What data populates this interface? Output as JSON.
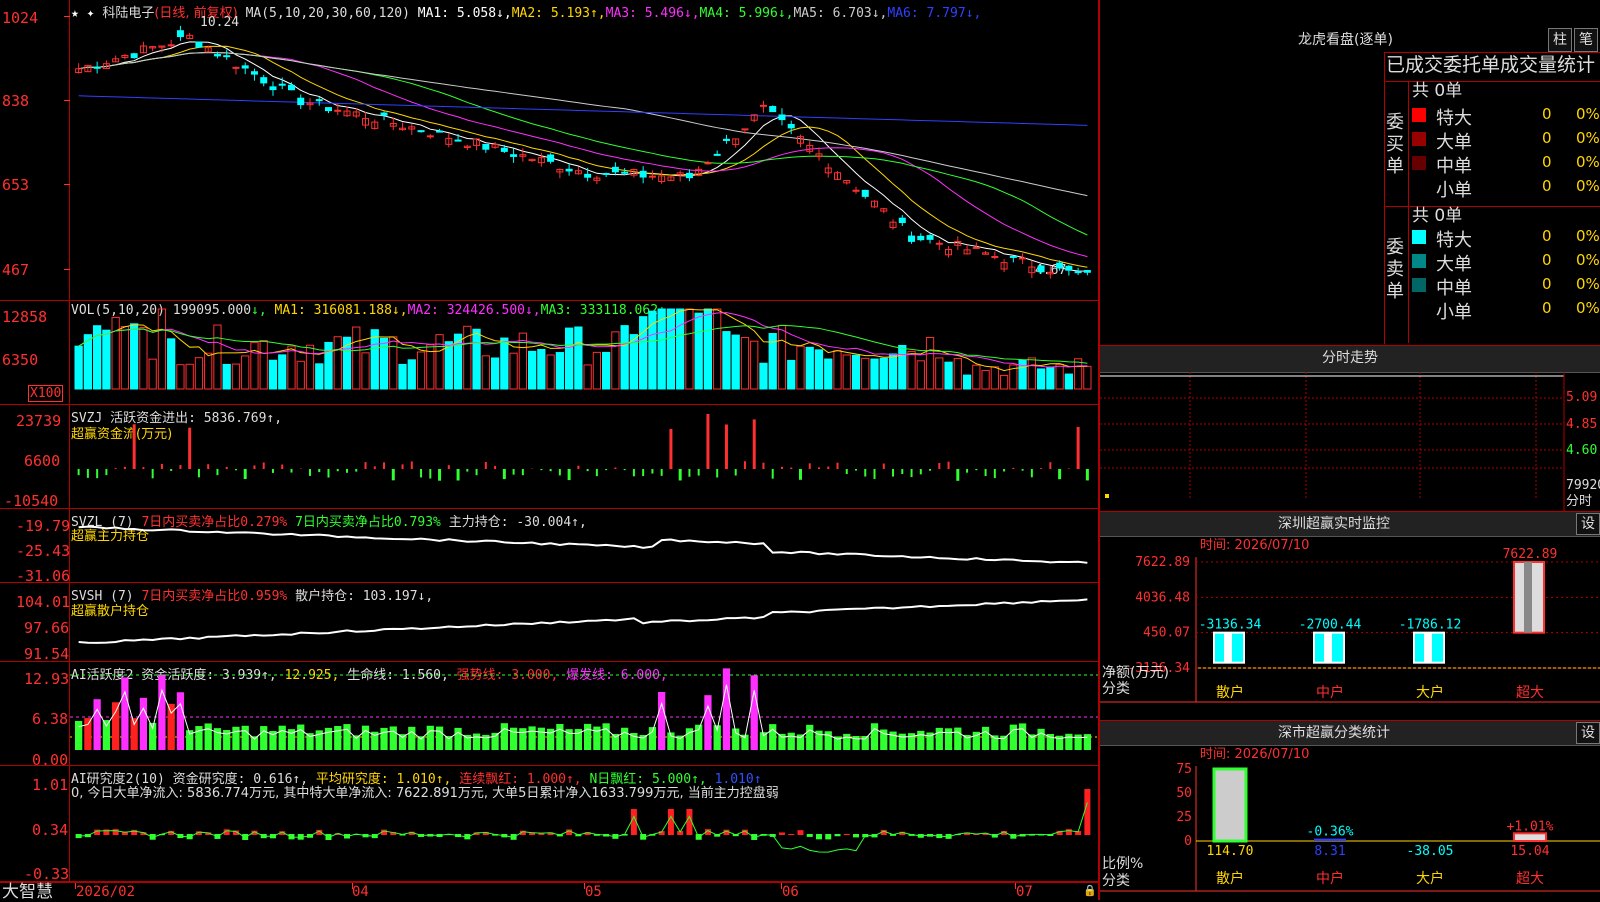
{
  "stock": {
    "name": "科陆电子",
    "mode": "(日线, 前复权)",
    "hi_label": "10.24",
    "lo_label": "4.67"
  },
  "price_pane": {
    "ma_label": "MA(5,10,20,30,60,120)",
    "items": [
      {
        "label": "MA1: 5.058",
        "arrow": "↓",
        "color": "#ffffff"
      },
      {
        "label": "MA2: 5.193",
        "arrow": "↑",
        "color": "#ffd700"
      },
      {
        "label": "MA3: 5.496",
        "arrow": "↓",
        "color": "#ff30ff"
      },
      {
        "label": "MA4: 5.996",
        "arrow": "↓",
        "color": "#30ff30"
      },
      {
        "label": "MA5: 6.703",
        "arrow": "↓",
        "color": "#cccccc"
      },
      {
        "label": "MA6: 7.797",
        "arrow": "↓",
        "color": "#3040ff"
      }
    ],
    "y_ticks": [
      "1024",
      "838",
      "653",
      "467"
    ]
  },
  "vol_pane": {
    "label": "VOL(5,10,20)",
    "value": "199095.000",
    "items": [
      {
        "label": "MA1: 316081.188",
        "arrow": "↓",
        "color": "#ffd700"
      },
      {
        "label": "MA2: 324426.500",
        "arrow": "↓",
        "color": "#ff30ff"
      },
      {
        "label": "MA3: 333118.062",
        "arrow": "↓",
        "color": "#30ff30"
      }
    ],
    "y_ticks": [
      "12858",
      "6350"
    ],
    "unit": "X100"
  },
  "svzj_pane": {
    "label": "SVZJ",
    "title": "活跃资金进出: 5836.769↑,",
    "subtitle": "超赢资金流(万元)",
    "y_ticks": [
      "23739",
      "6600",
      "-10540"
    ]
  },
  "svzl_pane": {
    "label": "SVZL (7)",
    "t1": "7日内买卖净占比0.279%",
    "t2": "7日内买卖净占比0.793%",
    "t3": "主力持仓: -30.004↑,",
    "subtitle": "超赢主力持仓",
    "y_ticks": [
      "-19.79",
      "-25.43",
      "-31.06"
    ]
  },
  "svsh_pane": {
    "label": "SVSH (7)",
    "t1": "7日内买卖净占比0.959%",
    "t2": "散户持仓: 103.197↓,",
    "subtitle": "超赢散户持仓",
    "y_ticks": [
      "104.01",
      "97.66",
      "91.54"
    ]
  },
  "ai_active_pane": {
    "label": "AI活跃度2",
    "t1": "资金活跃度: 3.939↑,",
    "t2": "12.925,",
    "t3": "生命线: 1.560,",
    "t4": "强势线: 3.000,",
    "t5": "爆发线: 6.000,",
    "y_ticks": [
      "12.93",
      "6.38",
      "0.00"
    ]
  },
  "ai_research_pane": {
    "label": "AI研究度2(10)",
    "t1": "资金研究度: 0.616↑,",
    "t2": "平均研究度: 1.010↑,",
    "t3": "连续飘红: 1.000↑,",
    "t4": "N日飘红: 5.000↑,",
    "t5": "1.010↑",
    "summary": "0, 今日大单净流入: 5836.774万元, 其中特大单净流入: 7622.891万元, 大单5日累计净入1633.799万元, 当前主力控盘弱",
    "y_ticks": [
      "1.01",
      "0.34",
      "-0.33"
    ]
  },
  "xaxis": {
    "brand": "大智慧",
    "labels": [
      "2026/02",
      "04",
      "05",
      "06",
      "07"
    ]
  },
  "right": {
    "dragon_title": "龙虎看盘(逐单)",
    "btn_bar": "柱",
    "btn_pen": "笔",
    "tabs": "已成交委托单成交量统计",
    "buy": {
      "side": "委买单",
      "total": "共 0单",
      "rows": [
        {
          "label": "特大",
          "count": "0",
          "pct": "0%",
          "color": "#ff0000"
        },
        {
          "label": "大单",
          "count": "0",
          "pct": "0%",
          "color": "#990000"
        },
        {
          "label": "中单",
          "count": "0",
          "pct": "0%",
          "color": "#660000"
        },
        {
          "label": "小单",
          "count": "0",
          "pct": "0%",
          "color": ""
        }
      ]
    },
    "sell": {
      "side": "委卖单",
      "total": "共 0单",
      "rows": [
        {
          "label": "特大",
          "count": "0",
          "pct": "0%",
          "color": "#00ffff"
        },
        {
          "label": "大单",
          "count": "0",
          "pct": "0%",
          "color": "#008888"
        },
        {
          "label": "中单",
          "count": "0",
          "pct": "0%",
          "color": "#006666"
        },
        {
          "label": "小单",
          "count": "0",
          "pct": "0%",
          "color": ""
        }
      ]
    },
    "intraday": {
      "title": "分时走势",
      "y_ticks": [
        "5.09",
        "4.85",
        "4.60"
      ],
      "vol_label": "79920",
      "bottom_label": "分时"
    },
    "monitor": {
      "title": "深圳超赢实时监控",
      "btn": "设",
      "time": "时间: 2026/07/10",
      "y_ticks": [
        "7622.89",
        "4036.48",
        "450.07",
        "-3136.34"
      ],
      "y_name": "净额(万元)",
      "x_name": "分类",
      "categories": [
        "散户",
        "中户",
        "大户",
        "超大"
      ]
    },
    "classify": {
      "title": "深市超赢分类统计",
      "btn": "设",
      "time": "时间: 2026/07/10",
      "y_ticks": [
        "75",
        "50",
        "25",
        "0"
      ],
      "y_name": "比例%",
      "x_name": "分类",
      "categories": [
        "散户",
        "中户",
        "大户",
        "超大"
      ]
    }
  },
  "chart_data": [
    {
      "type": "bar",
      "title": "深圳超赢实时监控",
      "categories": [
        "散户",
        "中户",
        "大户",
        "超大"
      ],
      "values": [
        -3136.34,
        -2700.44,
        -1786.12,
        7622.89
      ],
      "ylim": [
        -3136.34,
        7622.89
      ],
      "xlabel": "分类",
      "ylabel": "净额(万元)"
    },
    {
      "type": "bar",
      "title": "深市超赢分类统计",
      "categories": [
        "散户",
        "中户",
        "大户",
        "超大"
      ],
      "values": [
        114.7,
        8.31,
        -38.05,
        15.04
      ],
      "annotations": [
        "",
        "-0.36%",
        "",
        "+1.01%"
      ],
      "ylim": [
        0,
        75
      ],
      "xlabel": "分类",
      "ylabel": "比例%"
    }
  ]
}
